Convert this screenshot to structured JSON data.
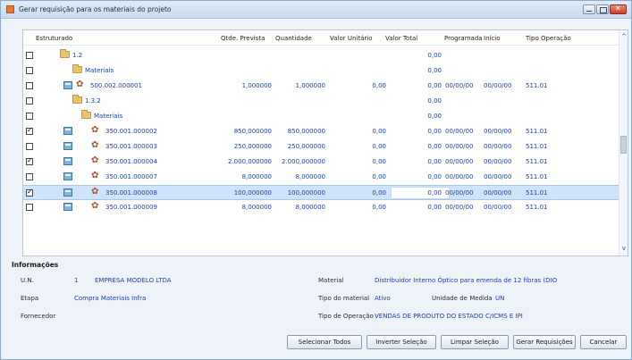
{
  "window": {
    "title": "Gerar requisição para os materiais do projeto"
  },
  "grid": {
    "columns": [
      "Estruturado",
      "Qtde. Prevista",
      "Quantidade",
      "Valor Unitário",
      "Valor Total",
      "Programada",
      "Início",
      "Tipo Operação"
    ],
    "rows": [
      {
        "checked": false,
        "kind": "folder",
        "code": "1.2",
        "qtde": "",
        "quant": "",
        "unit": "",
        "total": "0,00",
        "prog": "",
        "inicio": "",
        "tipo": ""
      },
      {
        "checked": false,
        "kind": "folder",
        "code": "Materiais",
        "qtde": "",
        "quant": "",
        "unit": "",
        "total": "0,00",
        "prog": "",
        "inicio": "",
        "tipo": ""
      },
      {
        "checked": false,
        "kind": "product",
        "code": "500.002.000001",
        "qtde": "1,000000",
        "quant": "1,000000",
        "unit": "0,00",
        "total": "0,00",
        "prog": "00/00/00",
        "inicio": "00/00/00",
        "tipo": "511.01"
      },
      {
        "checked": false,
        "kind": "folder",
        "code": "1.3.2",
        "qtde": "",
        "quant": "",
        "unit": "",
        "total": "0,00",
        "prog": "",
        "inicio": "",
        "tipo": ""
      },
      {
        "checked": false,
        "kind": "folder",
        "code": "Materiais",
        "qtde": "",
        "quant": "",
        "unit": "",
        "total": "0,00",
        "prog": "",
        "inicio": "",
        "tipo": ""
      },
      {
        "checked": true,
        "kind": "product",
        "code": "350.001.000002",
        "qtde": "850,000000",
        "quant": "850,000000",
        "unit": "0,00",
        "total": "0,00",
        "prog": "00/00/00",
        "inicio": "00/00/00",
        "tipo": "511.01"
      },
      {
        "checked": false,
        "kind": "product",
        "code": "350.001.000003",
        "qtde": "250,000000",
        "quant": "250,000000",
        "unit": "0,00",
        "total": "0,00",
        "prog": "00/00/00",
        "inicio": "00/00/00",
        "tipo": "511.01"
      },
      {
        "checked": true,
        "kind": "product",
        "code": "350.001.000004",
        "qtde": "2.000,000000",
        "quant": "2.000,000000",
        "unit": "0,00",
        "total": "0,00",
        "prog": "00/00/00",
        "inicio": "00/00/00",
        "tipo": "511.01"
      },
      {
        "checked": false,
        "kind": "product",
        "code": "350.001.000007",
        "qtde": "8,000000",
        "quant": "8,000000",
        "unit": "0,00",
        "total": "0,00",
        "prog": "00/00/00",
        "inicio": "00/00/00",
        "tipo": "511.01"
      },
      {
        "checked": true,
        "kind": "product",
        "code": "350.001.000008",
        "qtde": "100,000000",
        "quant": "100,000000",
        "unit": "0,00",
        "total": "0,00",
        "prog": "00/00/00",
        "inicio": "00/00/00",
        "tipo": "511.01",
        "selected": true
      },
      {
        "checked": false,
        "kind": "product",
        "code": "350.001.000009",
        "qtde": "8,000000",
        "quant": "8,000000",
        "unit": "0,00",
        "total": "0,00",
        "prog": "00/00/00",
        "inicio": "00/00/00",
        "tipo": "511.01"
      }
    ]
  },
  "info": {
    "title": "Informações",
    "un_label": "U.N.",
    "un_code": "1",
    "un_name": "EMPRESA MODELO LTDA",
    "etapa_label": "Etapa",
    "etapa_value": "Compra Materiais Infra",
    "fornecedor_label": "Fornecedor",
    "material_label": "Material",
    "material_value": "Distribuidor Interno Óptico para emenda de 12 fibras (DIO",
    "tipo_material_label": "Tipo do material",
    "tipo_material_value": "Ativo",
    "unidade_label": "Unidade de Medida",
    "unidade_value": "UN",
    "tipo_operacao_label": "Tipo de Operação",
    "tipo_operacao_value": "VENDAS DE PRODUTO DO ESTADO C/ICMS E IPI"
  },
  "buttons": {
    "selecionar_todos": "Selecionar Todos",
    "inverter_selecao": "Inverter Seleção",
    "limpar_selecao": "Limpar Seleção",
    "gerar_requisicoes": "Gerar Requisições",
    "cancelar": "Cancelar"
  }
}
